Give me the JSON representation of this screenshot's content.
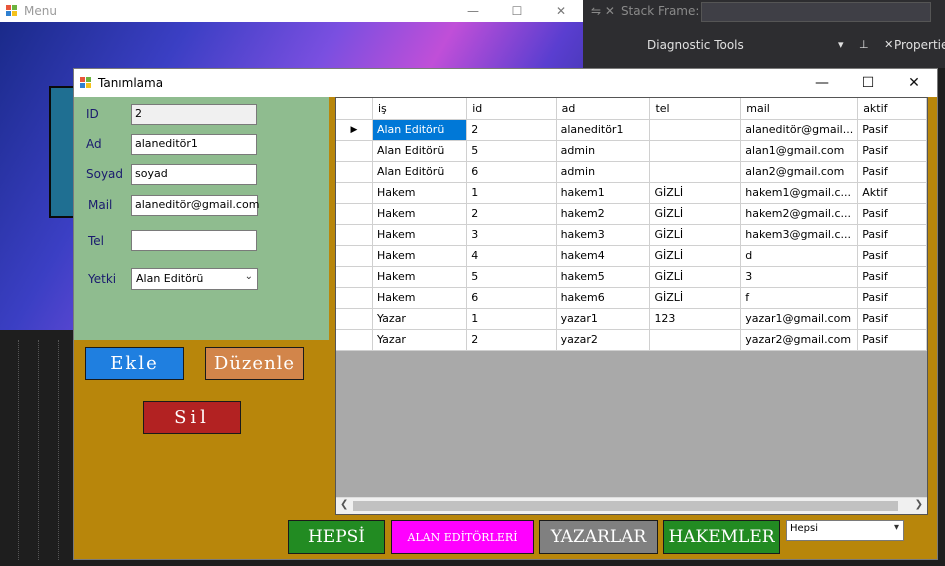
{
  "menu_window": {
    "title": "Menu"
  },
  "vs": {
    "stack_frame_label": "Stack Frame:",
    "diagnostic_tools": "Diagnostic Tools",
    "properties": "Properties"
  },
  "form": {
    "title": "Tanımlama",
    "labels": {
      "id": "ID",
      "ad": "Ad",
      "soyad": "Soyad",
      "mail": "Mail",
      "tel": "Tel",
      "yetki": "Yetki"
    },
    "fields": {
      "id": "2",
      "ad": "alaneditör1",
      "soyad": "soyad",
      "mail": "alaneditör@gmail.com",
      "tel": "",
      "yetki": "Alan Editörü"
    },
    "buttons": {
      "ekle": "Ekle",
      "duzenle": "Düzenle",
      "sil": "Sil",
      "hepsi": "HEPSİ",
      "alan": "ALAN EDİTÖRLERİ",
      "yazar": "YAZARLAR",
      "hakem": "HAKEMLER"
    },
    "filter_value": "Hepsi"
  },
  "grid": {
    "columns": [
      "iş",
      "id",
      "ad",
      "tel",
      "mail",
      "aktif"
    ],
    "rows": [
      [
        "Alan Editörü",
        "2",
        "alaneditör1",
        "",
        "alaneditör@gmail...",
        "Pasif"
      ],
      [
        "Alan Editörü",
        "5",
        "admin",
        "",
        "alan1@gmail.com",
        "Pasif"
      ],
      [
        "Alan Editörü",
        "6",
        "admin",
        "",
        "alan2@gmail.com",
        "Pasif"
      ],
      [
        "Hakem",
        "1",
        "hakem1",
        "GİZLİ",
        "hakem1@gmail.c...",
        "Aktif"
      ],
      [
        "Hakem",
        "2",
        "hakem2",
        "GİZLİ",
        "hakem2@gmail.c...",
        "Pasif"
      ],
      [
        "Hakem",
        "3",
        "hakem3",
        "GİZLİ",
        "hakem3@gmail.c...",
        "Pasif"
      ],
      [
        "Hakem",
        "4",
        "hakem4",
        "GİZLİ",
        "d",
        "Pasif"
      ],
      [
        "Hakem",
        "5",
        "hakem5",
        "GİZLİ",
        "3",
        "Pasif"
      ],
      [
        "Hakem",
        "6",
        "hakem6",
        "GİZLİ",
        "f",
        "Pasif"
      ],
      [
        "Yazar",
        "1",
        "yazar1",
        "123",
        "yazar1@gmail.com",
        "Pasif"
      ],
      [
        "Yazar",
        "2",
        "yazar2",
        "",
        "yazar2@gmail.com",
        "Pasif"
      ]
    ],
    "selected_row": 0
  }
}
